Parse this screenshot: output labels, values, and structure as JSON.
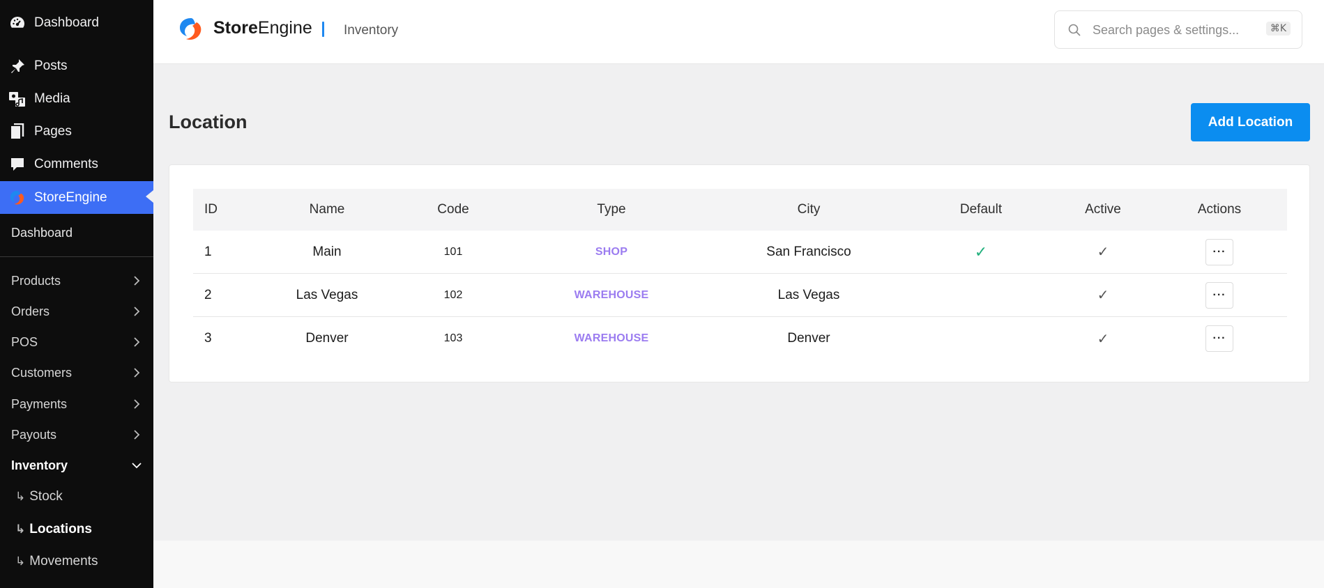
{
  "wp_menu": [
    {
      "label": "Dashboard",
      "icon": "dashboard-icon"
    },
    {
      "label": "Posts",
      "icon": "pin-icon"
    },
    {
      "label": "Media",
      "icon": "media-icon"
    },
    {
      "label": "Pages",
      "icon": "pages-icon"
    },
    {
      "label": "Comments",
      "icon": "comments-icon"
    },
    {
      "label": "StoreEngine",
      "icon": "storeengine-icon",
      "active": true
    }
  ],
  "storeengine_menu": {
    "dashboard": "Dashboard",
    "items": [
      {
        "label": "Products"
      },
      {
        "label": "Orders"
      },
      {
        "label": "POS"
      },
      {
        "label": "Customers"
      },
      {
        "label": "Payments"
      },
      {
        "label": "Payouts"
      },
      {
        "label": "Inventory",
        "expanded": true
      }
    ],
    "children": [
      {
        "label": "Stock"
      },
      {
        "label": "Locations",
        "current": true
      },
      {
        "label": "Movements"
      }
    ],
    "child_prefix": "↳"
  },
  "header": {
    "brand_strong": "Store",
    "brand_light": "Engine",
    "breadcrumb": "Inventory",
    "search_placeholder": "Search pages & settings...",
    "shortcut": "⌘K"
  },
  "main": {
    "title": "Location",
    "add_button": "Add Location",
    "table": {
      "headers": {
        "id": "ID",
        "name": "Name",
        "code": "Code",
        "type": "Type",
        "city": "City",
        "default": "Default",
        "active": "Active",
        "actions": "Actions"
      },
      "rows": [
        {
          "id": "1",
          "name": "Main",
          "code": "101",
          "type": "SHOP",
          "city": "San Francisco",
          "default": "✓",
          "active": "✓",
          "actions": "···"
        },
        {
          "id": "2",
          "name": "Las Vegas",
          "code": "102",
          "type": "WAREHOUSE",
          "city": "Las Vegas",
          "default": "",
          "active": "✓",
          "actions": "···"
        },
        {
          "id": "3",
          "name": "Denver",
          "code": "103",
          "type": "WAREHOUSE",
          "city": "Denver",
          "default": "",
          "active": "✓",
          "actions": "···"
        }
      ]
    }
  },
  "colors": {
    "sidebar_bg": "#0d0d0d",
    "active_menu": "#3d6ef5",
    "primary_button": "#0b8df0",
    "type_tag": "#9b7cf0",
    "default_check": "#22b07d"
  }
}
